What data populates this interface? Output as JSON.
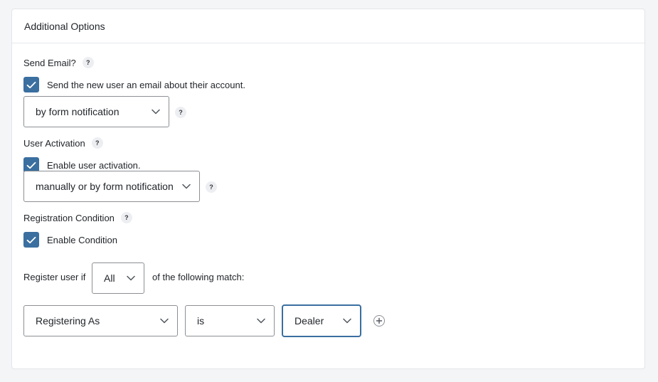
{
  "header": {
    "title": "Additional Options"
  },
  "send_email": {
    "label": "Send Email?",
    "help": "?",
    "checkbox_label": "Send the new user an email about their account.",
    "checked": true,
    "select_value": "by form notification",
    "select_help": "?"
  },
  "user_activation": {
    "label": "User Activation",
    "help": "?",
    "checkbox_label": "Enable user activation.",
    "checked": true,
    "select_value": "manually or by form notification",
    "select_help": "?"
  },
  "registration_condition": {
    "label": "Registration Condition",
    "help": "?",
    "checkbox_label": "Enable Condition",
    "checked": true
  },
  "condition_rule": {
    "prefix": "Register user if",
    "match_value": "All",
    "suffix": "of the following match:",
    "field_value": "Registering As",
    "operator_value": "is",
    "target_value": "Dealer"
  },
  "colors": {
    "accent": "#3a6fa0",
    "border": "#8c8f94",
    "panel_bg": "#ffffff",
    "page_bg": "#f4f5f7"
  }
}
